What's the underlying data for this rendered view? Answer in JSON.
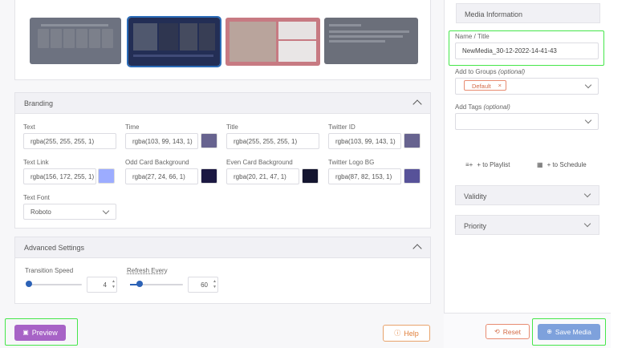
{
  "colors": {
    "accent": "#2c62b6",
    "preview": "#a763c6",
    "save": "#7ea1dc",
    "reset": "#d36a46",
    "highlight": "#45e64a"
  },
  "branding": {
    "title": "Branding",
    "fields": [
      {
        "label": "Text",
        "value": "rgba(255, 255, 255, 1)",
        "swatch": "#ffffff"
      },
      {
        "label": "Time",
        "value": "rgba(103, 99, 143, 1)",
        "swatch": "#67638f"
      },
      {
        "label": "Title",
        "value": "rgba(255, 255, 255, 1)",
        "swatch": "#ffffff"
      },
      {
        "label": "Twitter ID",
        "value": "rgba(103, 99, 143, 1)",
        "swatch": "#67638f"
      },
      {
        "label": "Text Link",
        "value": "rgba(156, 172, 255, 1)",
        "swatch": "#9cacff"
      },
      {
        "label": "Odd Card Background",
        "value": "rgba(27, 24, 66, 1)",
        "swatch": "#1b1842"
      },
      {
        "label": "Even Card Background",
        "value": "rgba(20, 21, 47, 1)",
        "swatch": "#14152f"
      },
      {
        "label": "Twitter Logo BG",
        "value": "rgba(87, 82, 153, 1)",
        "swatch": "#575299"
      }
    ],
    "font_label": "Text Font",
    "font_value": "Roboto"
  },
  "advanced": {
    "title": "Advanced Settings",
    "transition_label": "Transition Speed",
    "transition_value": "4",
    "refresh_label": "Refresh Every",
    "refresh_value": "60"
  },
  "buttons": {
    "preview": "Preview",
    "help": "Help",
    "reset": "Reset",
    "save": "Save Media"
  },
  "media_info": {
    "header": "Media Information",
    "name_label": "Name / Title",
    "name_value": "NewMedia_30-12-2022-14-41-43",
    "groups_label": "Add to Groups",
    "groups_optional": "(optional)",
    "group_tag": "Default",
    "tags_label": "Add Tags",
    "tags_optional": "(optional)",
    "to_playlist": "+ to Playlist",
    "to_schedule": "+ to Schedule",
    "validity": "Validity",
    "priority": "Priority"
  }
}
